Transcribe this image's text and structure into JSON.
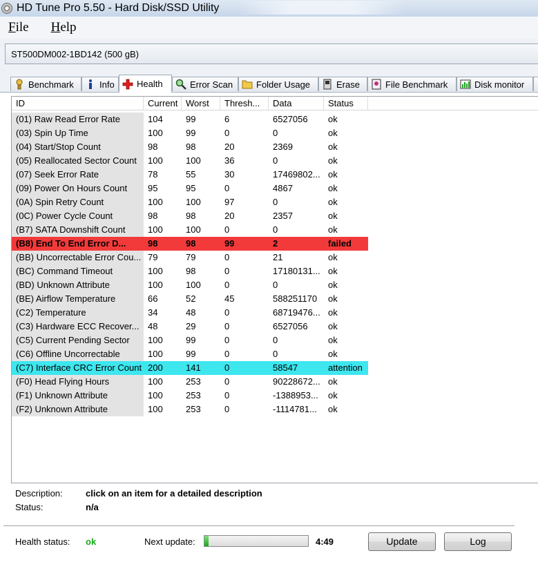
{
  "window": {
    "title": "HD Tune Pro 5.50 - Hard Disk/SSD Utility"
  },
  "menu": {
    "file": {
      "key": "F",
      "rest": "ile"
    },
    "help": {
      "key": "H",
      "rest": "elp"
    }
  },
  "device": {
    "selected": "ST500DM002-1BD142 (500 gB)"
  },
  "tabs": [
    {
      "label": "Benchmark",
      "icon": "benchmark-icon"
    },
    {
      "label": "Info",
      "icon": "info-icon"
    },
    {
      "label": "Health",
      "icon": "health-cross-icon",
      "active": true
    },
    {
      "label": "Error Scan",
      "icon": "magnifier-icon"
    },
    {
      "label": "Folder Usage",
      "icon": "folder-icon"
    },
    {
      "label": "Erase",
      "icon": "erase-icon"
    },
    {
      "label": "File Benchmark",
      "icon": "file-benchmark-icon"
    },
    {
      "label": "Disk monitor",
      "icon": "disk-monitor-icon"
    }
  ],
  "columns": [
    "ID",
    "Current",
    "Worst",
    "Thresh...",
    "Data",
    "Status"
  ],
  "rows": [
    {
      "id": "(01) Raw Read Error Rate",
      "current": "104",
      "worst": "99",
      "thresh": "6",
      "data": "6527056",
      "status": "ok"
    },
    {
      "id": "(03) Spin Up Time",
      "current": "100",
      "worst": "99",
      "thresh": "0",
      "data": "0",
      "status": "ok"
    },
    {
      "id": "(04) Start/Stop Count",
      "current": "98",
      "worst": "98",
      "thresh": "20",
      "data": "2369",
      "status": "ok"
    },
    {
      "id": "(05) Reallocated Sector Count",
      "current": "100",
      "worst": "100",
      "thresh": "36",
      "data": "0",
      "status": "ok"
    },
    {
      "id": "(07) Seek Error Rate",
      "current": "78",
      "worst": "55",
      "thresh": "30",
      "data": "17469802...",
      "status": "ok"
    },
    {
      "id": "(09) Power On Hours Count",
      "current": "95",
      "worst": "95",
      "thresh": "0",
      "data": "4867",
      "status": "ok"
    },
    {
      "id": "(0A) Spin Retry Count",
      "current": "100",
      "worst": "100",
      "thresh": "97",
      "data": "0",
      "status": "ok"
    },
    {
      "id": "(0C) Power Cycle Count",
      "current": "98",
      "worst": "98",
      "thresh": "20",
      "data": "2357",
      "status": "ok"
    },
    {
      "id": "(B7) SATA Downshift Count",
      "current": "100",
      "worst": "100",
      "thresh": "0",
      "data": "0",
      "status": "ok"
    },
    {
      "id": "(B8) End To End Error D...",
      "current": "98",
      "worst": "98",
      "thresh": "99",
      "data": "2",
      "status": "failed",
      "highlight": "failed"
    },
    {
      "id": "(BB) Uncorrectable Error Cou...",
      "current": "79",
      "worst": "79",
      "thresh": "0",
      "data": "21",
      "status": "ok"
    },
    {
      "id": "(BC) Command Timeout",
      "current": "100",
      "worst": "98",
      "thresh": "0",
      "data": "17180131...",
      "status": "ok"
    },
    {
      "id": "(BD) Unknown Attribute",
      "current": "100",
      "worst": "100",
      "thresh": "0",
      "data": "0",
      "status": "ok"
    },
    {
      "id": "(BE) Airflow Temperature",
      "current": "66",
      "worst": "52",
      "thresh": "45",
      "data": "588251170",
      "status": "ok"
    },
    {
      "id": "(C2) Temperature",
      "current": "34",
      "worst": "48",
      "thresh": "0",
      "data": "68719476...",
      "status": "ok"
    },
    {
      "id": "(C3) Hardware ECC Recover...",
      "current": "48",
      "worst": "29",
      "thresh": "0",
      "data": "6527056",
      "status": "ok"
    },
    {
      "id": "(C5) Current Pending Sector",
      "current": "100",
      "worst": "99",
      "thresh": "0",
      "data": "0",
      "status": "ok"
    },
    {
      "id": "(C6) Offline Uncorrectable",
      "current": "100",
      "worst": "99",
      "thresh": "0",
      "data": "0",
      "status": "ok"
    },
    {
      "id": "(C7) Interface CRC Error Count",
      "current": "200",
      "worst": "141",
      "thresh": "0",
      "data": "58547",
      "status": "attention",
      "highlight": "attention"
    },
    {
      "id": "(F0) Head Flying Hours",
      "current": "100",
      "worst": "253",
      "thresh": "0",
      "data": "90228672...",
      "status": "ok"
    },
    {
      "id": "(F1) Unknown Attribute",
      "current": "100",
      "worst": "253",
      "thresh": "0",
      "data": "-1388953...",
      "status": "ok"
    },
    {
      "id": "(F2) Unknown Attribute",
      "current": "100",
      "worst": "253",
      "thresh": "0",
      "data": "-1114781...",
      "status": "ok"
    }
  ],
  "colors": {
    "failed": "#f23a3a",
    "attention": "#3ee6ee",
    "health_ok": "#1aa81a"
  },
  "details": {
    "description_label": "Description:",
    "description_value": "click on an item for a detailed description",
    "status_label": "Status:",
    "status_value": "n/a"
  },
  "footer": {
    "health_label": "Health status:",
    "health_value": "ok",
    "next_update_label": "Next update:",
    "next_update_progress": 0.04,
    "countdown": "4:49",
    "update_button": "Update",
    "log_button": "Log"
  }
}
